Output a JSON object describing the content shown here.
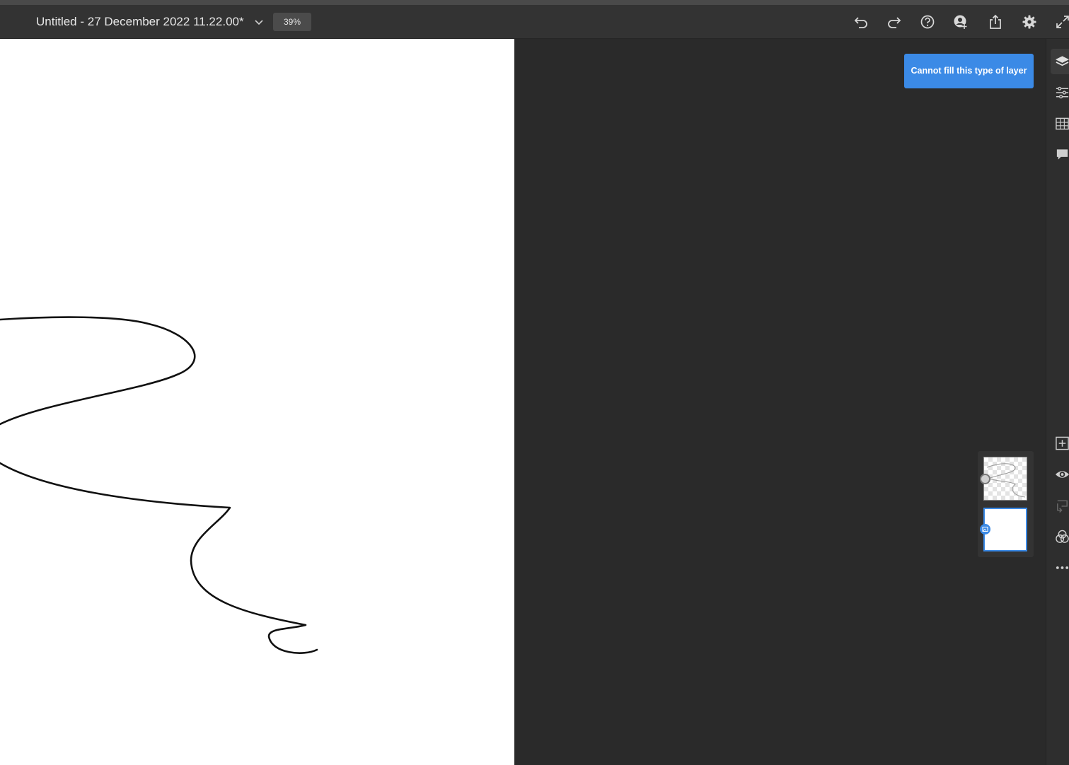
{
  "document": {
    "title": "Untitled - 27 December 2022 11.22.00*",
    "zoom": "39%"
  },
  "toolbar": {
    "icons": [
      "undo-icon",
      "redo-icon",
      "help-icon",
      "invite-user-icon",
      "share-icon",
      "gear-icon",
      "expand-icon"
    ]
  },
  "toast": {
    "message": "Cannot fill this type of layer",
    "color": "#3b8ae6"
  },
  "right_rail": {
    "top_icons": [
      "layers-icon",
      "adjustments-icon",
      "grid-icon",
      "comment-icon"
    ],
    "bottom_icons": [
      "add-layer-icon",
      "visibility-icon",
      "merge-icon",
      "blend-icon",
      "more-icon"
    ]
  },
  "layers": [
    {
      "name": "stroke-layer",
      "thumbnail": "checker-with-stroke",
      "selected": false
    },
    {
      "name": "background-layer",
      "thumbnail": "white",
      "selected": true
    }
  ],
  "colors": {
    "accent": "#3b8ae6",
    "topbar": "#333333",
    "workspace": "#2a2a2a",
    "canvas": "#ffffff"
  }
}
